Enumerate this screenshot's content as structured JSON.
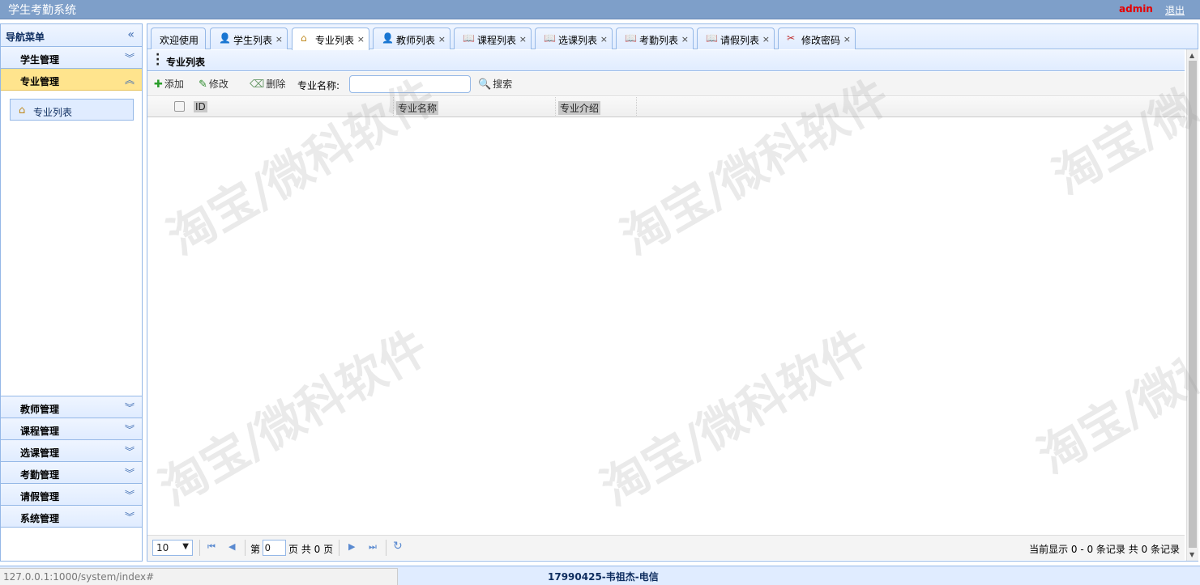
{
  "app": {
    "title": "学生考勤系统",
    "user": "admin",
    "logout": "退出"
  },
  "nav": {
    "title": "导航菜单",
    "groups_top": [
      {
        "label": "学生管理"
      },
      {
        "label": "专业管理"
      }
    ],
    "sub_item": "专业列表",
    "groups_bottom": [
      {
        "label": "教师管理"
      },
      {
        "label": "课程管理"
      },
      {
        "label": "选课管理"
      },
      {
        "label": "考勤管理"
      },
      {
        "label": "请假管理"
      },
      {
        "label": "系统管理"
      }
    ]
  },
  "tabs": [
    {
      "label": "欢迎使用"
    },
    {
      "label": "学生列表"
    },
    {
      "label": "专业列表"
    },
    {
      "label": "教师列表"
    },
    {
      "label": "课程列表"
    },
    {
      "label": "选课列表"
    },
    {
      "label": "考勤列表"
    },
    {
      "label": "请假列表"
    },
    {
      "label": "修改密码"
    }
  ],
  "content": {
    "title": "专业列表",
    "toolbar": {
      "add": "添加",
      "edit": "修改",
      "delete": "删除",
      "search_label": "专业名称:",
      "search_value": "",
      "search_button": "搜索"
    },
    "columns": [
      "ID",
      "专业名称",
      "专业介绍"
    ]
  },
  "pager": {
    "page_size": "10",
    "page_prefix": "第",
    "page_value": "0",
    "page_suffix": "页 共 0 页",
    "info": "当前显示 0 - 0 条记录 共 0 条记录"
  },
  "statusbar": {
    "url": "127.0.0.1:1000/system/index#",
    "footer": "17990425-韦祖杰-电信"
  },
  "watermark": "淘宝/微科软件",
  "colors": {
    "accent": "#95b8e7",
    "selected": "#ffe48d",
    "header": "#7e9fc9",
    "user": "#e60000"
  }
}
